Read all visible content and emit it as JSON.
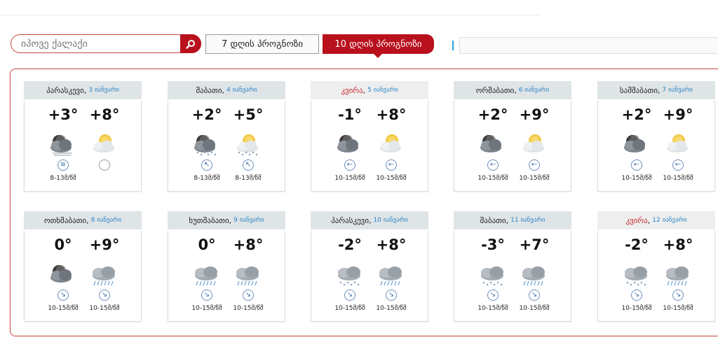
{
  "search": {
    "placeholder": "იპოვე ქალაქი"
  },
  "tabs": {
    "seven_day": "7 დღის პროგნოზი",
    "ten_day": "10 დღის პროგნოზი"
  },
  "colors": {
    "accent_red": "#b8101c",
    "link_blue": "#2a86c8",
    "header_gray": "#dfe4e7"
  },
  "days": [
    {
      "name": "პარასკევი",
      "date": "3 იანვარი",
      "sunday": false,
      "temps": [
        "+3°",
        "+8°"
      ],
      "icons": [
        "night-cloudy-fog-icon",
        "sun-cloud-icon"
      ],
      "winds": [
        "wind-icon",
        "calm-icon"
      ],
      "speeds": [
        "8-13მ/წმ",
        ""
      ]
    },
    {
      "name": "შაბათი",
      "date": "4 იანვარი",
      "sunday": false,
      "temps": [
        "+2°",
        "+5°"
      ],
      "icons": [
        "night-snow-icon",
        "sun-snow-icon"
      ],
      "winds": [
        "wind-arrow-icon",
        "wind-arrow-icon"
      ],
      "speeds": [
        "8-13მ/წმ",
        "8-13მ/წმ"
      ]
    },
    {
      "name": "კვირა",
      "date": "5 იანვარი",
      "sunday": true,
      "temps": [
        "-1°",
        "+8°"
      ],
      "icons": [
        "night-cloudy-icon",
        "sun-cloud-icon"
      ],
      "winds": [
        "wind-arrow-icon",
        "wind-arrow-icon"
      ],
      "speeds": [
        "10-15მ/წმ",
        "10-15მ/წმ"
      ]
    },
    {
      "name": "ორშაბათი",
      "date": "6 იანვარი",
      "sunday": false,
      "temps": [
        "+2°",
        "+9°"
      ],
      "icons": [
        "night-cloudy-icon",
        "sun-cloud-icon"
      ],
      "winds": [
        "wind-arrow-icon",
        "wind-arrow-icon"
      ],
      "speeds": [
        "10-15მ/წმ",
        "10-15მ/წმ"
      ]
    },
    {
      "name": "სამშაბათი",
      "date": "7 იანვარი",
      "sunday": false,
      "temps": [
        "+2°",
        "+9°"
      ],
      "icons": [
        "night-cloudy-icon",
        "sun-cloud-icon"
      ],
      "winds": [
        "wind-arrow-icon",
        "wind-arrow-icon"
      ],
      "speeds": [
        "10-15მ/წმ",
        "10-15მ/წმ"
      ]
    },
    {
      "name": "ოთხშაბათი",
      "date": "8 იანვარი",
      "sunday": false,
      "temps": [
        "0°",
        "+9°"
      ],
      "icons": [
        "night-cloudy-icon",
        "rain-cloud-icon"
      ],
      "winds": [
        "wind-arrow-icon",
        "wind-arrow-icon"
      ],
      "speeds": [
        "10-15მ/წმ",
        "10-15მ/წმ"
      ]
    },
    {
      "name": "ხუთშაბათი",
      "date": "9 იანვარი",
      "sunday": false,
      "temps": [
        "0°",
        "+8°"
      ],
      "icons": [
        "rain-cloud-icon",
        "rain-cloud-icon"
      ],
      "winds": [
        "wind-arrow-icon",
        "wind-arrow-icon"
      ],
      "speeds": [
        "10-15მ/წმ",
        "10-15მ/წმ"
      ]
    },
    {
      "name": "პარასკევი",
      "date": "10 იანვარი",
      "sunday": false,
      "temps": [
        "-2°",
        "+8°"
      ],
      "icons": [
        "snow-cloud-icon",
        "rain-cloud-icon"
      ],
      "winds": [
        "wind-arrow-icon",
        "wind-arrow-icon"
      ],
      "speeds": [
        "10-15მ/წმ",
        "10-15მ/წმ"
      ]
    },
    {
      "name": "შაბათი",
      "date": "11 იანვარი",
      "sunday": false,
      "temps": [
        "-3°",
        "+7°"
      ],
      "icons": [
        "snow-cloud-icon",
        "rain-cloud-icon"
      ],
      "winds": [
        "wind-arrow-icon",
        "wind-arrow-icon"
      ],
      "speeds": [
        "10-15მ/წმ",
        "10-15მ/წმ"
      ]
    },
    {
      "name": "კვირა",
      "date": "12 იანვარი",
      "sunday": true,
      "temps": [
        "-2°",
        "+8°"
      ],
      "icons": [
        "snow-cloud-icon",
        "rain-cloud-icon"
      ],
      "winds": [
        "wind-arrow-icon",
        "wind-arrow-icon"
      ],
      "speeds": [
        "10-15მ/წმ",
        "10-15მ/წმ"
      ]
    }
  ]
}
